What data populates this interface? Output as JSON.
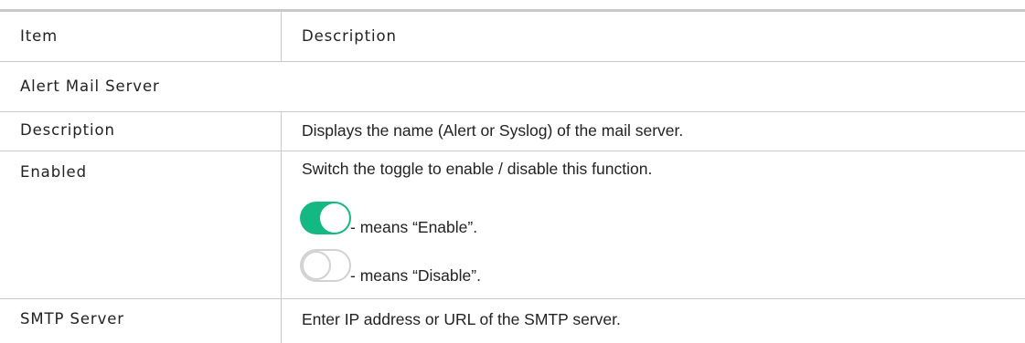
{
  "table": {
    "header": {
      "item": "Item",
      "description": "Description"
    },
    "section_title": "Alert Mail Server",
    "rows": [
      {
        "item": "Description",
        "description": "Displays the name (Alert or Syslog) of the mail server."
      },
      {
        "item": "Enabled",
        "description": "Switch the toggle to enable / disable this function.",
        "toggle_on_caption": "- means “Enable”.",
        "toggle_off_caption": "- means “Disable”."
      },
      {
        "item": "SMTP Server",
        "description": "Enter IP address or URL of the SMTP server."
      }
    ]
  },
  "colors": {
    "toggle_on": "#14b883",
    "toggle_off_border": "#d2d2d2",
    "rule": "#c9c9c9"
  },
  "icons": {
    "toggle_on": "toggle-on-icon",
    "toggle_off": "toggle-off-icon"
  }
}
